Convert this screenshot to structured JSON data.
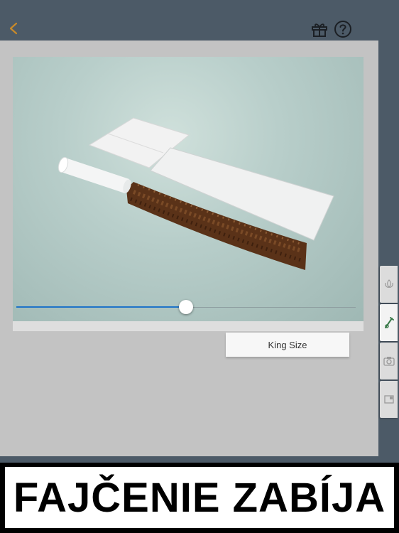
{
  "header": {
    "back_icon": "chevron-left-icon",
    "gift_icon": "gift-icon",
    "help_icon": "question-circle-icon",
    "accent_color": "#c98a2a",
    "icon_color": "#1b1f24"
  },
  "viewer": {
    "slider": {
      "value": 0.5,
      "fill_color": "#1e73c8"
    },
    "size_label": "King Size"
  },
  "side_tabs": [
    {
      "icon": "leaf-icon",
      "active": false
    },
    {
      "icon": "rolling-tool-icon",
      "active": true,
      "color": "#3a7a4a"
    },
    {
      "icon": "camera-icon",
      "active": false
    },
    {
      "icon": "card-icon",
      "active": false
    }
  ],
  "warning": {
    "text": "FAJČENIE ZABÍJA"
  }
}
